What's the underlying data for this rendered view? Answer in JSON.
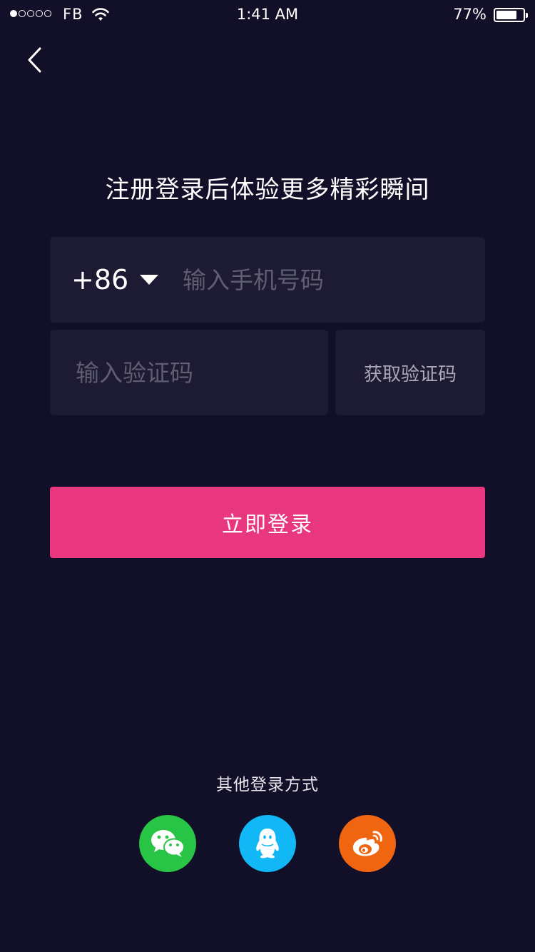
{
  "status_bar": {
    "signal_filled": 1,
    "signal_total": 5,
    "carrier": "FB",
    "time": "1:41 AM",
    "battery_text": "77%",
    "battery_level": 0.77
  },
  "login": {
    "heading": "注册登录后体验更多精彩瞬间",
    "country_code": "+86",
    "phone_placeholder": "输入手机号码",
    "code_placeholder": "输入验证码",
    "get_code_label": "获取验证码",
    "submit_label": "立即登录"
  },
  "other_login": {
    "label": "其他登录方式",
    "providers": [
      {
        "icon": "wechat-icon",
        "color": "#28C445"
      },
      {
        "icon": "qq-icon",
        "color": "#12B7F5"
      },
      {
        "icon": "weibo-icon",
        "color": "#F0650F"
      }
    ]
  },
  "colors": {
    "background": "#120F29",
    "field": "#1D1A33",
    "accent": "#E9377F",
    "placeholder": "#5F5D70"
  }
}
